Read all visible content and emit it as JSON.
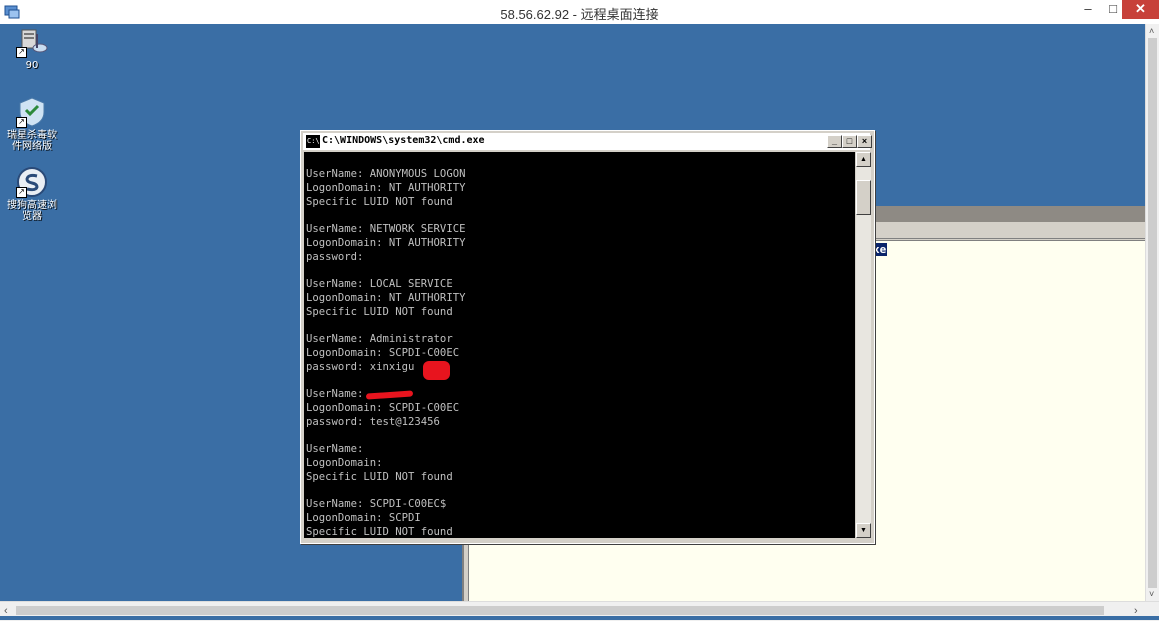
{
  "rdp_window": {
    "title": "58.56.62.92 - 远程桌面连接",
    "minimize_glyph": "–",
    "maximize_glyph": "□",
    "close_glyph": "✕"
  },
  "desktop": {
    "icons": [
      {
        "label": "90",
        "icon": "network-computer-icon"
      },
      {
        "label": "瑞星杀毒软件网络版",
        "icon": "antivirus-shield-icon"
      },
      {
        "label": "搜狗高速浏览器",
        "icon": "sogou-browser-icon"
      }
    ]
  },
  "background_window": {
    "selected_text": "xe"
  },
  "cmd": {
    "title": "C:\\WINDOWS\\system32\\cmd.exe",
    "icon_text": "C:\\",
    "minimize_glyph": "_",
    "maximize_glyph": "□",
    "close_glyph": "×",
    "lines": [
      "UserName: ANONYMOUS LOGON",
      "LogonDomain: NT AUTHORITY",
      "Specific LUID NOT found",
      "",
      "UserName: NETWORK SERVICE",
      "LogonDomain: NT AUTHORITY",
      "password:",
      "",
      "UserName: LOCAL SERVICE",
      "LogonDomain: NT AUTHORITY",
      "Specific LUID NOT found",
      "",
      "UserName: Administrator",
      "LogonDomain: SCPDI-C00EC",
      "password: xinxigu",
      "",
      "UserName:",
      "LogonDomain: SCPDI-C00EC",
      "password: test@123456",
      "",
      "UserName:",
      "LogonDomain:",
      "Specific LUID NOT found",
      "",
      "UserName: SCPDI-C00EC$",
      "LogonDomain: SCPDI",
      "Specific LUID NOT found"
    ],
    "scroll_up_glyph": "▲",
    "scroll_down_glyph": "▼"
  },
  "scrollbars": {
    "up_glyph": "˄",
    "down_glyph": "˅",
    "left_glyph": "‹",
    "right_glyph": "›"
  },
  "colors": {
    "desktop": "#3a6ea5",
    "console_bg": "#000000",
    "console_text": "#c0c0c0",
    "redaction": "#e8141e",
    "rdp_close": "#c7413a"
  }
}
